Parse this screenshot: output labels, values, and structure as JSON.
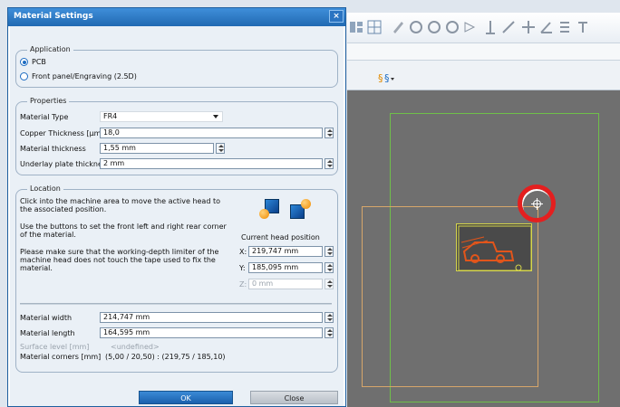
{
  "dialog": {
    "title": "Material Settings",
    "close_glyph": "×"
  },
  "application": {
    "legend": "Application",
    "options": [
      "PCB",
      "Front panel/Engraving (2.5D)"
    ],
    "selected": "PCB"
  },
  "properties": {
    "legend": "Properties",
    "material_type": {
      "label": "Material Type",
      "value": "FR4"
    },
    "copper_thickness": {
      "label": "Copper Thickness [µm]",
      "value": "18,0"
    },
    "material_thickness": {
      "label": "Material thickness",
      "value": "1,55 mm"
    },
    "underlay_thickness": {
      "label": "Underlay plate thickness",
      "value": "2 mm"
    }
  },
  "location": {
    "legend": "Location",
    "instruction1": "Click into the machine area to move the active head to the associated position.",
    "instruction2": "Use the buttons to set the front left and right rear corner of the material.",
    "instruction3": "Please make sure that the working-depth limiter of the machine head does not touch the tape used to fix the material.",
    "head_position_title": "Current head position",
    "x": {
      "label": "X:",
      "value": "219,747 mm"
    },
    "y": {
      "label": "Y:",
      "value": "185,095 mm"
    },
    "z": {
      "label": "Z:",
      "value": "0 mm"
    },
    "set_front_left_icon": "set-front-left-corner-icon",
    "set_rear_right_icon": "set-rear-right-corner-icon"
  },
  "material": {
    "width": {
      "label": "Material width",
      "value": "214,747 mm"
    },
    "length": {
      "label": "Material length",
      "value": "164,595 mm"
    },
    "surface": {
      "label": "Surface level [mm]",
      "value": "<undefined>"
    },
    "corners": {
      "label": "Material corners [mm]",
      "value": "(5,00 / 20,50) : (219,75 / 185,10)"
    }
  },
  "buttons": {
    "ok": "OK",
    "close": "Close"
  },
  "colors": {
    "titlebar": "#2a74c2",
    "ok_button": "#1f6dc2",
    "marker": "#e41f1f",
    "canvas": "#6f6f6f",
    "work_area_outline": "#6fbf4a",
    "material_outline": "#d7a66a"
  }
}
